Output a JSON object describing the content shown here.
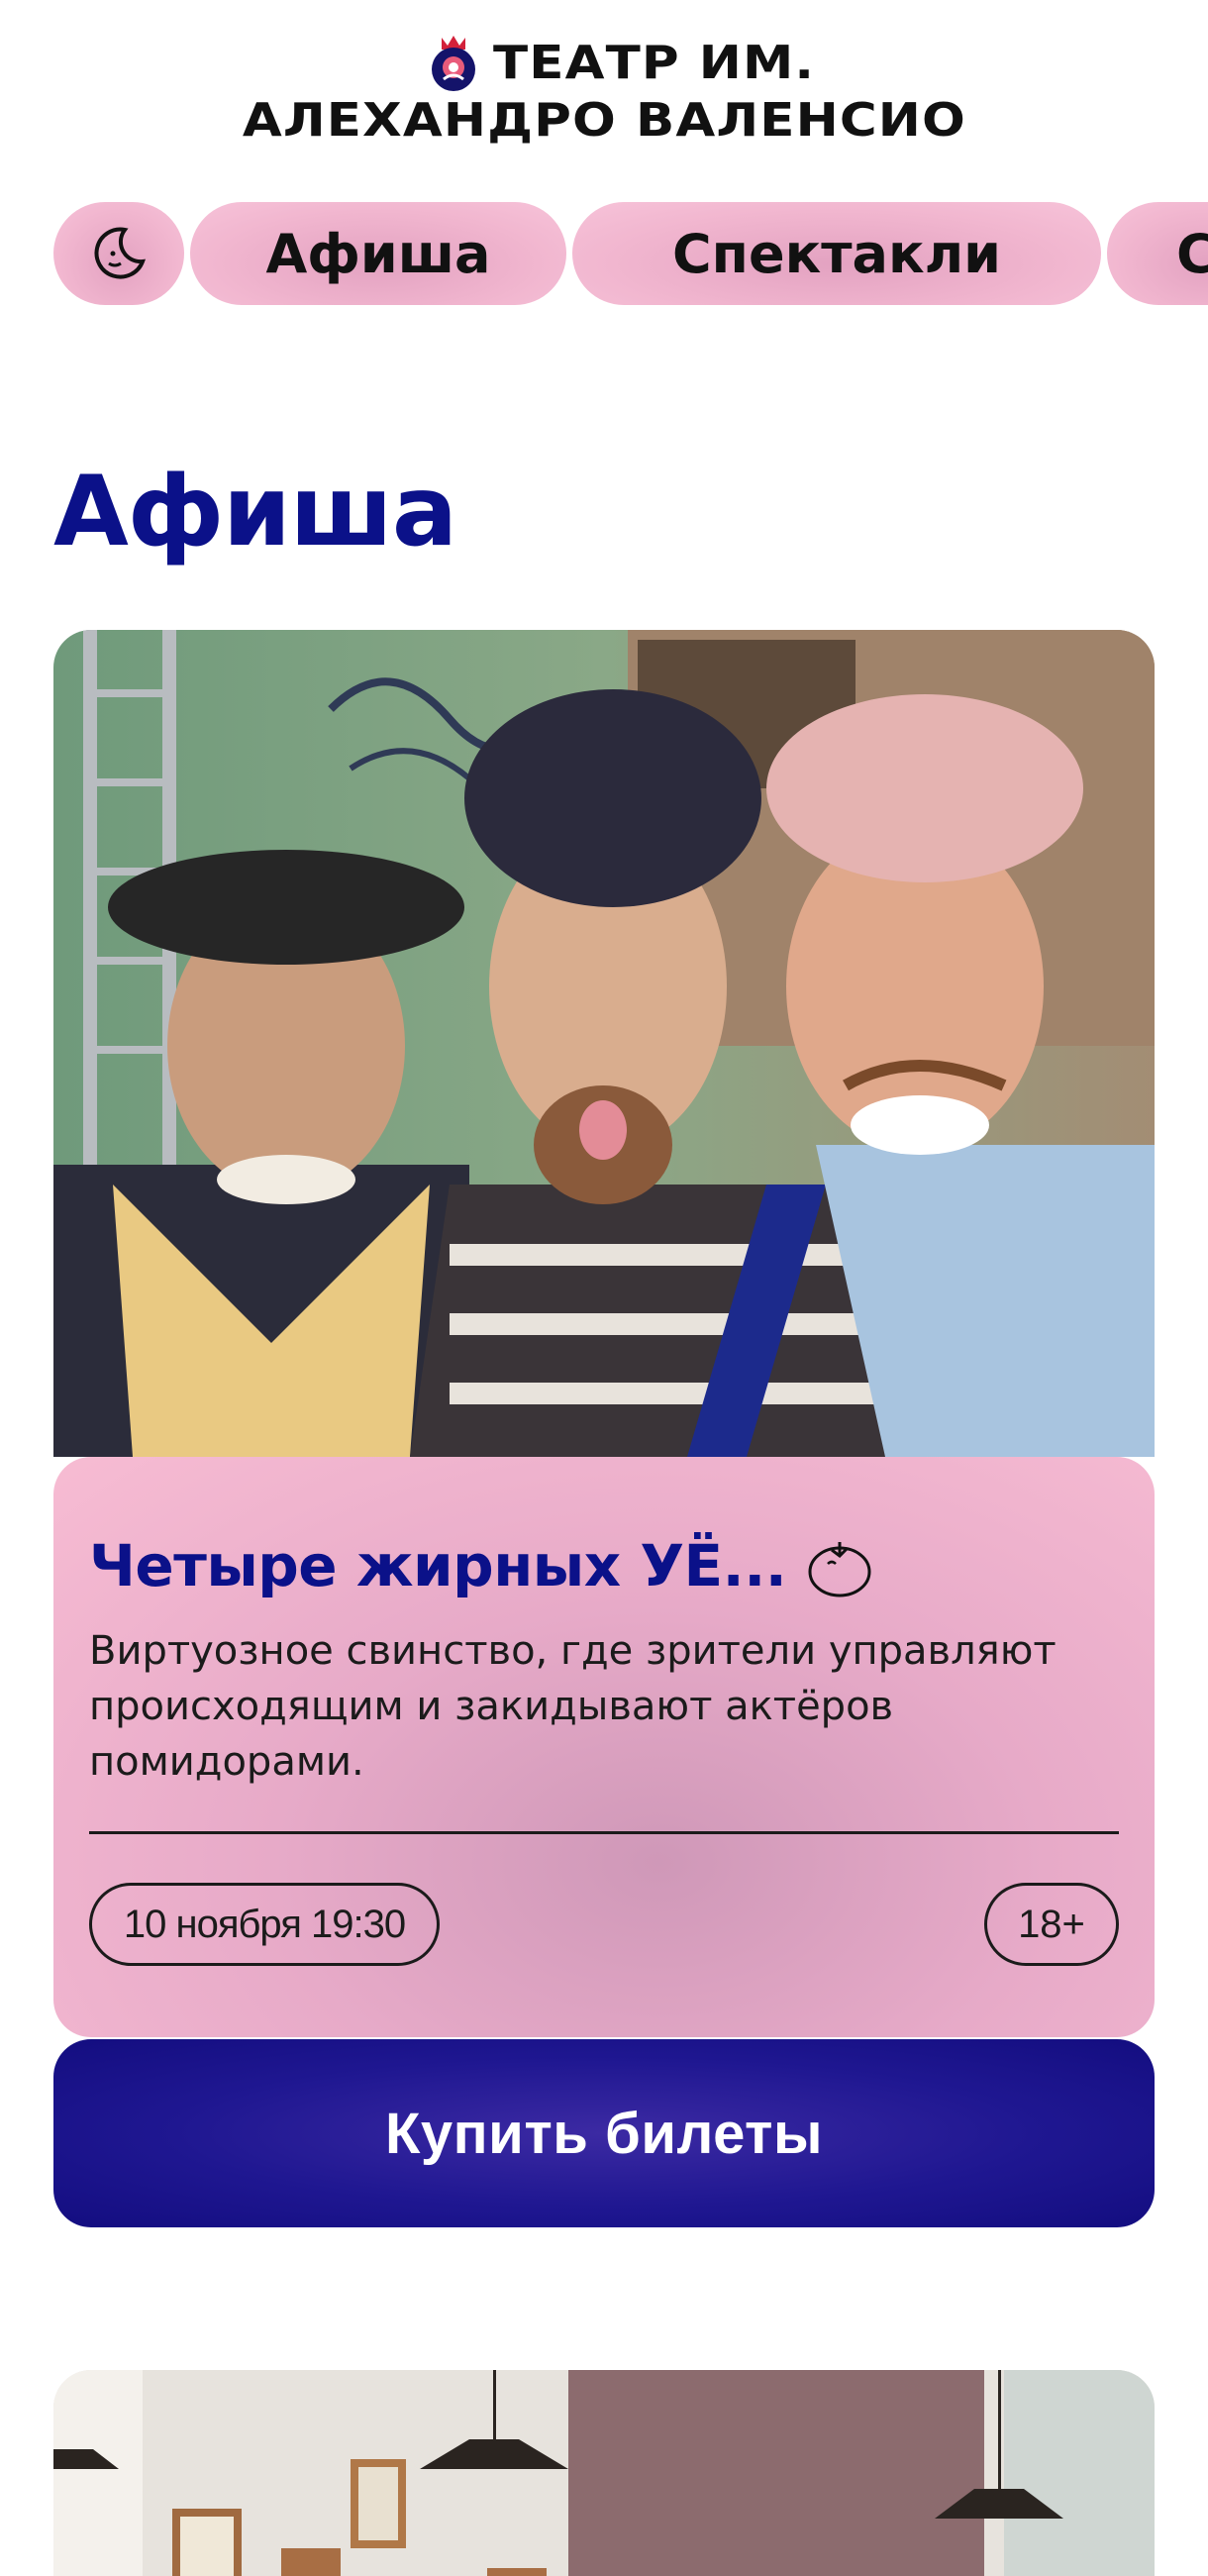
{
  "header": {
    "logo_line1": "ТЕАТР ИМ.",
    "logo_line2": "АЛЕХАНДРО ВАЛЕНСИО",
    "logo_icon": "theatre-emblem-icon"
  },
  "nav": {
    "theme_toggle_icon": "moon-icon",
    "items": [
      {
        "label": "Афиша"
      },
      {
        "label": "Спектакли"
      },
      {
        "label": "С"
      }
    ]
  },
  "main": {
    "section_title": "Афиша",
    "events": [
      {
        "title": "Четыре жирных УЁ...",
        "title_icon": "tomato-icon",
        "description": "Виртуозное свинство, где зрители управляют происходящим и закидывают актёров помидорами.",
        "date": "10 ноября 19:30",
        "age": "18+",
        "buy_label": "Купить билеты"
      }
    ]
  },
  "colors": {
    "accent_blue": "#0b1189",
    "pill_pink": "#f1b6cf",
    "button_blue": "#1f1791"
  }
}
